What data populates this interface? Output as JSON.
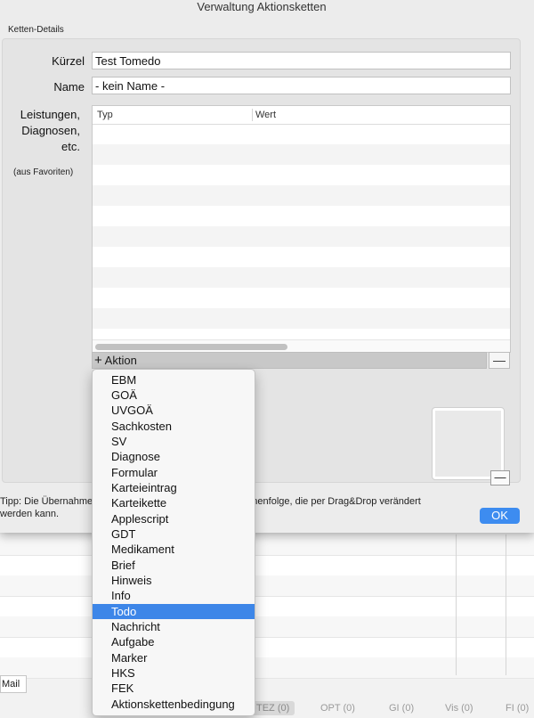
{
  "window": {
    "title": "Verwaltung Aktionsketten"
  },
  "group": {
    "label": "Ketten-Details"
  },
  "fields": {
    "kuerzel": {
      "label": "Kürzel",
      "value": "Test Tomedo"
    },
    "name": {
      "label": "Name",
      "value": "- kein Name -"
    }
  },
  "items_label": {
    "line1": "Leistungen,",
    "line2": "Diagnosen,",
    "line3": "etc."
  },
  "favorites_note": "(aus Favoriten)",
  "table": {
    "columns": [
      "Typ",
      "Wert"
    ]
  },
  "action_bar": {
    "plus": "+",
    "label": "Aktion",
    "minus": "—"
  },
  "preview": {
    "minus": "—"
  },
  "tip": {
    "part1": "Tipp: Die Übernahme",
    "part2": "benen Reihenfolge, die per Drag&Drop verändert",
    "line2": "werden kann."
  },
  "ok_button": "OK",
  "menu": {
    "items": [
      "EBM",
      "GOÄ",
      "UVGOÄ",
      "Sachkosten",
      "SV",
      "Diagnose",
      "Formular",
      "Karteieintrag",
      "Karteikette",
      "Applescript",
      "GDT",
      "Medikament",
      "Brief",
      "Hinweis",
      "Info",
      "Todo",
      "Nachricht",
      "Aufgabe",
      "Marker",
      "HKS",
      "FEK",
      "Aktionskettenbedingung"
    ],
    "highlighted": "Todo"
  },
  "background": {
    "mail_tab": "Mail",
    "tabs": [
      "TEZ (0)",
      "OPT (0)",
      "GI (0)",
      "Vis (0)",
      "FI (0)"
    ],
    "selected_tab": "TEZ (0)"
  }
}
